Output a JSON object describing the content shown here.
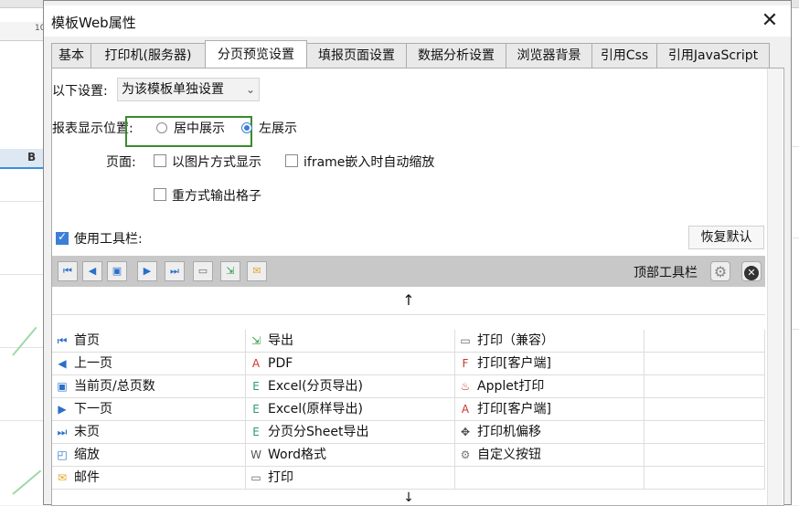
{
  "dialog": {
    "title": "模板Web属性",
    "close": "✕"
  },
  "tabs": [
    {
      "label": "基本"
    },
    {
      "label": "打印机(服务器)"
    },
    {
      "label": "分页预览设置"
    },
    {
      "label": "填报页面设置"
    },
    {
      "label": "数据分析设置"
    },
    {
      "label": "浏览器背景"
    },
    {
      "label": "引用Css"
    },
    {
      "label": "引用JavaScript"
    }
  ],
  "active_tab": "分页预览设置",
  "settings": {
    "scope_label": "以下设置:",
    "scope_value": "为该模板单独设置",
    "position_label": "报表显示位置:",
    "position_options": [
      "居中展示",
      "左展示"
    ],
    "position_selected": "左展示",
    "page_label": "页面:",
    "page_options": [
      "以图片方式显示",
      "iframe嵌入时自动缩放",
      "重方式输出格子"
    ]
  },
  "toolbar": {
    "use_label": "使用工具栏:",
    "use_checked": true,
    "restore_label": "恢复默认",
    "location_label": "顶部工具栏",
    "buttons": [
      "first-page",
      "prev-page",
      "current-total",
      "next-page",
      "last-page",
      "print",
      "export",
      "mail"
    ],
    "up_arrow": "↑",
    "down_arrow": "↓"
  },
  "items": [
    [
      {
        "icon": "first-page-icon",
        "glyph": "⏮",
        "color": "#2a6fc9",
        "label": "首页"
      },
      {
        "icon": "export-icon",
        "glyph": "⇲",
        "color": "#2f9a43",
        "label": "导出"
      },
      {
        "icon": "printer-icon",
        "glyph": "▭",
        "color": "#666",
        "label": "打印（兼容）"
      }
    ],
    [
      {
        "icon": "prev-page-icon",
        "glyph": "◀",
        "color": "#2a6fc9",
        "label": "上一页"
      },
      {
        "icon": "pdf-icon",
        "glyph": "A",
        "color": "#d1342a",
        "label": "PDF"
      },
      {
        "icon": "flash-print-icon",
        "glyph": "F",
        "color": "#c0392b",
        "label": "打印[客户端]"
      }
    ],
    [
      {
        "icon": "current-total-icon",
        "glyph": "▣",
        "color": "#2a6fc9",
        "label": "当前页/总页数"
      },
      {
        "icon": "excel-icon",
        "glyph": "E",
        "color": "#2f9a6a",
        "label": "Excel(分页导出)"
      },
      {
        "icon": "applet-icon",
        "glyph": "♨",
        "color": "#c0392b",
        "label": "Applet打印"
      }
    ],
    [
      {
        "icon": "next-page-icon",
        "glyph": "▶",
        "color": "#2a6fc9",
        "label": "下一页"
      },
      {
        "icon": "excel-icon",
        "glyph": "E",
        "color": "#2f9a6a",
        "label": "Excel(原样导出)"
      },
      {
        "icon": "pdf-print-icon",
        "glyph": "A",
        "color": "#d1342a",
        "label": "打印[客户端]"
      }
    ],
    [
      {
        "icon": "last-page-icon",
        "glyph": "⏭",
        "color": "#2a6fc9",
        "label": "末页"
      },
      {
        "icon": "excel-icon",
        "glyph": "E",
        "color": "#2f9a6a",
        "label": "分页分Sheet导出"
      },
      {
        "icon": "move-icon",
        "glyph": "✥",
        "color": "#444",
        "label": "打印机偏移"
      }
    ],
    [
      {
        "icon": "zoom-icon",
        "glyph": "◰",
        "color": "#2a6fc9",
        "label": "缩放"
      },
      {
        "icon": "word-icon",
        "glyph": "W",
        "color": "#555",
        "label": "Word格式"
      },
      {
        "icon": "gear-icon",
        "glyph": "⚙",
        "color": "#777",
        "label": "自定义按钮"
      }
    ],
    [
      {
        "icon": "mail-icon",
        "glyph": "✉",
        "color": "#e8a22a",
        "label": "邮件"
      },
      {
        "icon": "printer-icon",
        "glyph": "▭",
        "color": "#666",
        "label": "打印"
      },
      {
        "icon": "",
        "glyph": "",
        "color": "#000",
        "label": ""
      }
    ]
  ],
  "background": {
    "ruler_tick": "10",
    "column_header": "B"
  }
}
